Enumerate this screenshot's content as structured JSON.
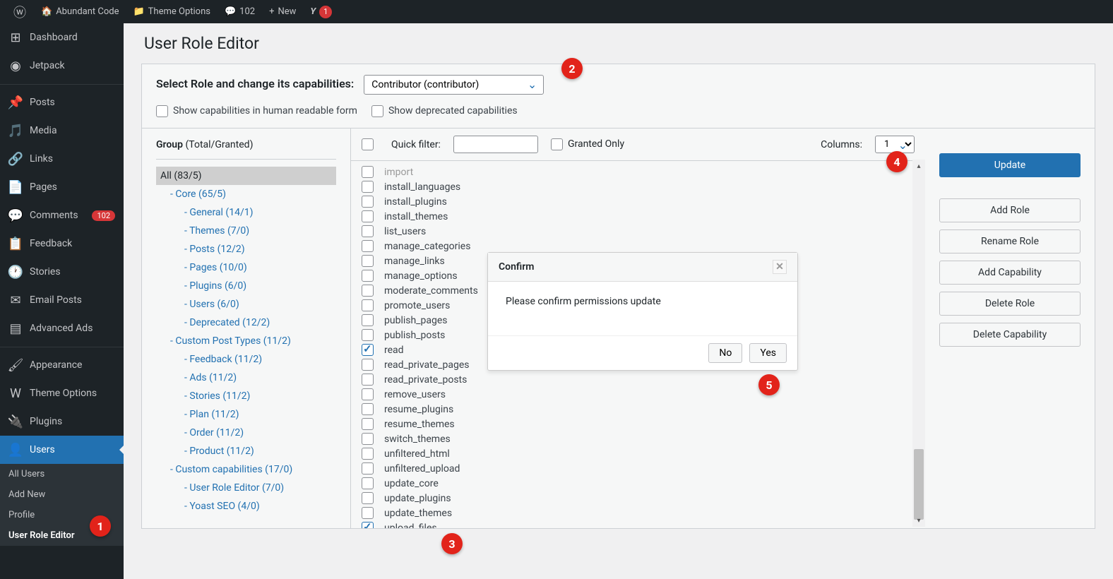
{
  "adminbar": {
    "site_name": "Abundant Code",
    "theme_options": "Theme Options",
    "comments_count": "102",
    "new": "New",
    "yoast_count": "1"
  },
  "sidebar": {
    "items": [
      {
        "label": "Dashboard",
        "icon": "dashboard"
      },
      {
        "label": "Jetpack",
        "icon": "jetpack"
      },
      {
        "label": "Posts",
        "icon": "pin"
      },
      {
        "label": "Media",
        "icon": "media"
      },
      {
        "label": "Links",
        "icon": "link"
      },
      {
        "label": "Pages",
        "icon": "page"
      },
      {
        "label": "Comments",
        "icon": "comment",
        "badge": "102"
      },
      {
        "label": "Feedback",
        "icon": "feedback"
      },
      {
        "label": "Stories",
        "icon": "clock"
      },
      {
        "label": "Email Posts",
        "icon": "email"
      },
      {
        "label": "Advanced Ads",
        "icon": "ads"
      },
      {
        "label": "Appearance",
        "icon": "brush"
      },
      {
        "label": "Theme Options",
        "icon": "w"
      },
      {
        "label": "Plugins",
        "icon": "plugin"
      },
      {
        "label": "Users",
        "icon": "user"
      }
    ],
    "submenu": [
      {
        "label": "All Users"
      },
      {
        "label": "Add New"
      },
      {
        "label": "Profile"
      },
      {
        "label": "User Role Editor"
      }
    ]
  },
  "page": {
    "title": "User Role Editor",
    "select_label": "Select Role and change its capabilities:",
    "selected_role": "Contributor (contributor)",
    "show_human": "Show capabilities in human readable form",
    "show_deprecated": "Show deprecated capabilities"
  },
  "groups": {
    "title": "Group",
    "subtitle": "(Total/Granted)",
    "items": [
      {
        "label": "All (83/5)",
        "level": 0,
        "selected": true
      },
      {
        "label": "- Core (65/5)",
        "level": 1
      },
      {
        "label": "- General (14/1)",
        "level": 2
      },
      {
        "label": "- Themes (7/0)",
        "level": 2
      },
      {
        "label": "- Posts (12/2)",
        "level": 2
      },
      {
        "label": "- Pages (10/0)",
        "level": 2
      },
      {
        "label": "- Plugins (6/0)",
        "level": 2
      },
      {
        "label": "- Users (6/0)",
        "level": 2
      },
      {
        "label": "- Deprecated (12/2)",
        "level": 2
      },
      {
        "label": "- Custom Post Types (11/2)",
        "level": 1
      },
      {
        "label": "- Feedback (11/2)",
        "level": 2
      },
      {
        "label": "- Ads (11/2)",
        "level": 2
      },
      {
        "label": "- Stories (11/2)",
        "level": 2
      },
      {
        "label": "- Plan (11/2)",
        "level": 2
      },
      {
        "label": "- Order (11/2)",
        "level": 2
      },
      {
        "label": "- Product (11/2)",
        "level": 2
      },
      {
        "label": "- Custom capabilities (17/0)",
        "level": 1
      },
      {
        "label": "- User Role Editor (7/0)",
        "level": 2
      },
      {
        "label": "- Yoast SEO (4/0)",
        "level": 2
      }
    ]
  },
  "filter": {
    "quick": "Quick filter:",
    "granted": "Granted Only",
    "columns_label": "Columns:",
    "columns_value": "1"
  },
  "caps": [
    {
      "name": "import",
      "checked": false,
      "faded": true
    },
    {
      "name": "install_languages",
      "checked": false
    },
    {
      "name": "install_plugins",
      "checked": false
    },
    {
      "name": "install_themes",
      "checked": false
    },
    {
      "name": "list_users",
      "checked": false
    },
    {
      "name": "manage_categories",
      "checked": false
    },
    {
      "name": "manage_links",
      "checked": false
    },
    {
      "name": "manage_options",
      "checked": false
    },
    {
      "name": "moderate_comments",
      "checked": false
    },
    {
      "name": "promote_users",
      "checked": false
    },
    {
      "name": "publish_pages",
      "checked": false
    },
    {
      "name": "publish_posts",
      "checked": false
    },
    {
      "name": "read",
      "checked": true
    },
    {
      "name": "read_private_pages",
      "checked": false
    },
    {
      "name": "read_private_posts",
      "checked": false
    },
    {
      "name": "remove_users",
      "checked": false
    },
    {
      "name": "resume_plugins",
      "checked": false
    },
    {
      "name": "resume_themes",
      "checked": false
    },
    {
      "name": "switch_themes",
      "checked": false
    },
    {
      "name": "unfiltered_html",
      "checked": false
    },
    {
      "name": "unfiltered_upload",
      "checked": false
    },
    {
      "name": "update_core",
      "checked": false
    },
    {
      "name": "update_plugins",
      "checked": false
    },
    {
      "name": "update_themes",
      "checked": false
    },
    {
      "name": "upload_files",
      "checked": true
    }
  ],
  "actions": {
    "update": "Update",
    "add_role": "Add Role",
    "rename_role": "Rename Role",
    "add_cap": "Add Capability",
    "delete_role": "Delete Role",
    "delete_cap": "Delete Capability"
  },
  "dialog": {
    "title": "Confirm",
    "message": "Please confirm permissions update",
    "no": "No",
    "yes": "Yes"
  },
  "markers": [
    "1",
    "2",
    "3",
    "4",
    "5"
  ]
}
